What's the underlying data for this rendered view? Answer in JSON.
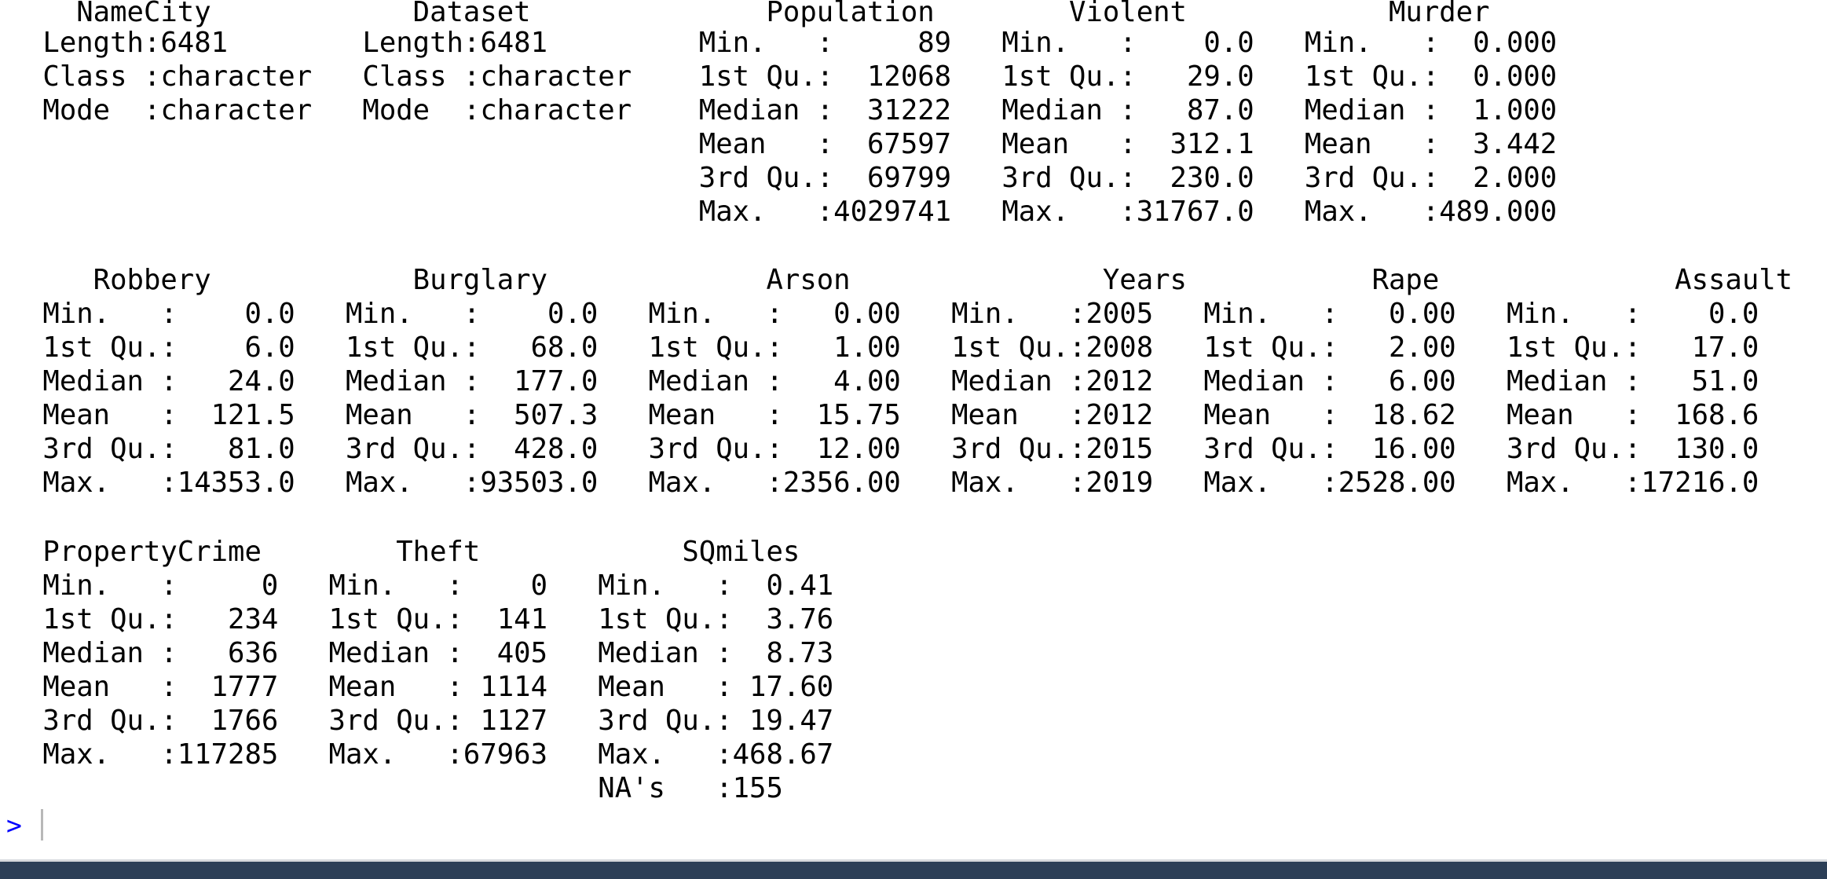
{
  "console": {
    "blocks": [
      {
        "header": "   NameCity            Dataset              Population        Violent            Murder",
        "rows": [
          " Length:6481        Length:6481         Min.   :     89   Min.   :    0.0   Min.   :  0.000",
          " Class :character   Class :character    1st Qu.:  12068   1st Qu.:   29.0   1st Qu.:  0.000",
          " Mode  :character   Mode  :character    Median :  31222   Median :   87.0   Median :  1.000",
          "                                        Mean   :  67597   Mean   :  312.1   Mean   :  3.442",
          "                                        3rd Qu.:  69799   3rd Qu.:  230.0   3rd Qu.:  2.000",
          "                                        Max.   :4029741   Max.   :31767.0   Max.   :489.000"
        ]
      },
      {
        "header": "    Robbery            Burglary             Arson               Years           Rape              Assault",
        "rows": [
          " Min.   :    0.0   Min.   :    0.0   Min.   :   0.00   Min.   :2005   Min.   :   0.00   Min.   :    0.0",
          " 1st Qu.:    6.0   1st Qu.:   68.0   1st Qu.:   1.00   1st Qu.:2008   1st Qu.:   2.00   1st Qu.:   17.0",
          " Median :   24.0   Median :  177.0   Median :   4.00   Median :2012   Median :   6.00   Median :   51.0",
          " Mean   :  121.5   Mean   :  507.3   Mean   :  15.75   Mean   :2012   Mean   :  18.62   Mean   :  168.6",
          " 3rd Qu.:   81.0   3rd Qu.:  428.0   3rd Qu.:  12.00   3rd Qu.:2015   3rd Qu.:  16.00   3rd Qu.:  130.0",
          " Max.   :14353.0   Max.   :93503.0   Max.   :2356.00   Max.   :2019   Max.   :2528.00   Max.   :17216.0"
        ]
      },
      {
        "header": " PropertyCrime        Theft            SQmiles",
        "rows": [
          " Min.   :     0   Min.   :    0   Min.   :  0.41",
          " 1st Qu.:   234   1st Qu.:  141   1st Qu.:  3.76",
          " Median :   636   Median :  405   Median :  8.73",
          " Mean   :  1777   Mean   : 1114   Mean   : 17.60",
          " 3rd Qu.:  1766   3rd Qu.: 1127   3rd Qu.: 19.47",
          " Max.   :117285   Max.   :67963   Max.   :468.67",
          "                                  NA's   :155"
        ]
      }
    ],
    "prompt": ">"
  },
  "colors": {
    "background": "#ffffff",
    "output_text": "#000000",
    "prompt": "#0000ff",
    "cursor": "#b8b8b8",
    "taskbar": "#2c3f57"
  }
}
